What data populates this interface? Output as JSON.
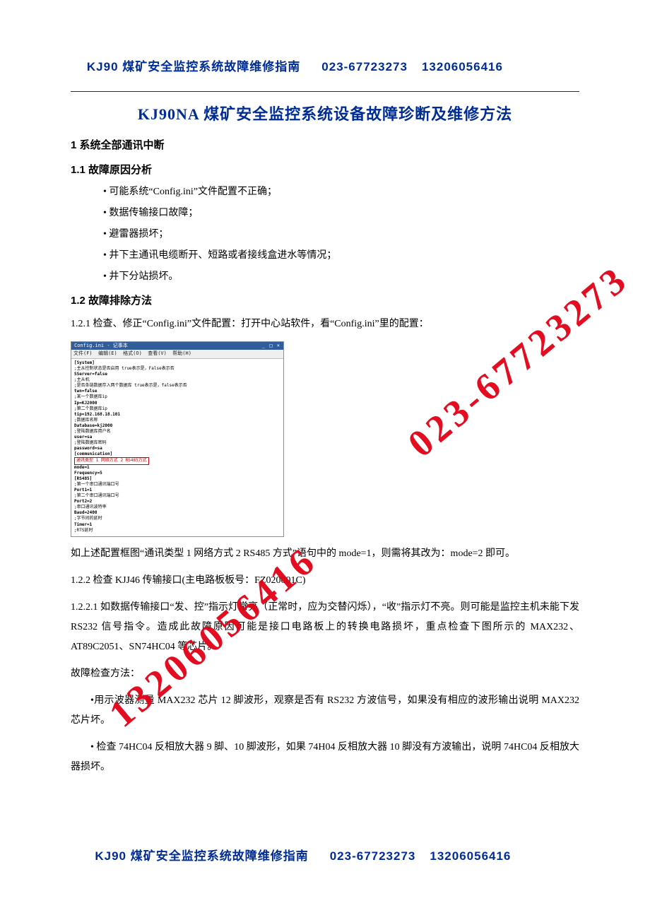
{
  "header": {
    "title": "KJ90 煤矿安全监控系统故障维修指南",
    "phone1": "023-67723273",
    "phone2": "13206056416"
  },
  "doc_title": "KJ90NA 煤矿安全监控系统设备故障珍断及维修方法",
  "s1": "1 系统全部通讯中断",
  "s1_1": "1.1 故障原因分析",
  "bullets": [
    "可能系统“Config.ini”文件配置不正确；",
    "数据传输接口故障；",
    "避雷器损坏；",
    "井下主通讯电缆断开、短路或者接线盒进水等情况；",
    "井下分站损坏。"
  ],
  "s1_2": "1.2 故障排除方法",
  "p1_2_1": "1.2.1 检查、修正“Config.ini”文件配置：打开中心站软件，看“Config.ini”里的配置：",
  "config_window": {
    "titlebar": "Config.ini - 记事本",
    "menubar": "文件(F)  编辑(E)  格式(O)  查看(V)  帮助(H)",
    "lines": [
      "[System]",
      ";主从控制状态是否启用 true表示是，False表示否",
      "SServer=false",
      ";主从机",
      ";是否条链数据存入两个数据库 true表示是，false表示否",
      "twn=false",
      ";某一个数据库ip",
      "Ip=KJ2000",
      ";第二个数据库ip",
      "tip=192.168.18.101",
      ";数据库名称",
      "Database=kj2000",
      ";登陆数据库用户名",
      "user=sa",
      ";登陆数据库密码",
      "password=sa",
      "[communication]",
      "通讯类型 1 网络方式 2 RS485方式",
      "mode=1",
      "Frequency=5",
      "[RS485]",
      ";第一个串口通讯端口号",
      "Port1=1",
      ";第二个串口通讯端口号",
      "Port2=2",
      ";串口通讯波特率",
      "Baud=2400",
      ";字节间的延时",
      "Timer=1",
      ";RTS延时"
    ],
    "highlight_index": 17
  },
  "p_after_config": "如上述配置框图“通讯类型 1 网络方式 2   RS485 方式”语句中的 mode=1，则需将其改为：mode=2 即可。",
  "p1_2_2": "1.2.2 检查 KJJ46 传输接口(主电路板板号：FZ020001C)",
  "p1_2_2_1": "1.2.2.1 如数据传输接口“发、控”指示灯常亮（正常时，应为交替闪烁），“收”指示灯不亮。则可能是监控主机未能下发 RS232 信号指令。造成此故障原因可能是接口电路板上的转换电路损坏，重点检查下图所示的 MAX232、AT89C2051、SN74HC04 等芯片。",
  "p_check_label": "故障检查方法：",
  "p_check1": "•用示波器测量 MAX232 芯片 12 脚波形，观察是否有 RS232 方波信号，如果没有相应的波形输出说明 MAX232 芯片坏。",
  "p_check2": "• 检查 74HC04 反相放大器 9 脚、10 脚波形，如果 74H04 反相放大器 10 脚没有方波输出，说明 74HC04 反相放大器损坏。",
  "watermarks": {
    "w1": "023-67723273",
    "w2": "13206056416"
  },
  "footer": {
    "title": "KJ90 煤矿安全监控系统故障维修指南",
    "phone1": "023-67723273",
    "phone2": "13206056416"
  }
}
